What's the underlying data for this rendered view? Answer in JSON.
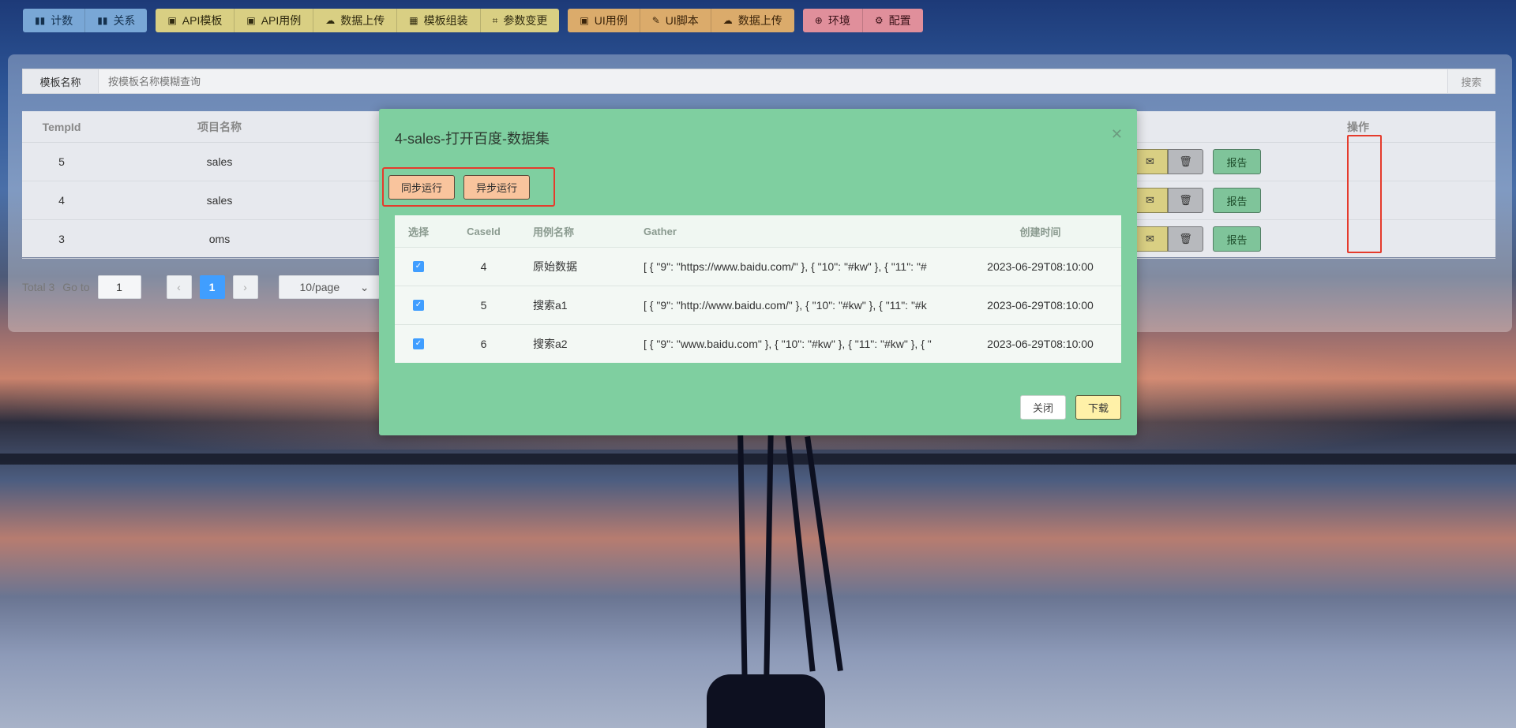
{
  "toolbar": {
    "groups": [
      {
        "color": "blue",
        "items": [
          {
            "icon": "bar-chart-icon",
            "label": "计数"
          },
          {
            "icon": "bar-chart-icon",
            "label": "关系"
          }
        ]
      },
      {
        "color": "yellow",
        "items": [
          {
            "icon": "clipboard-icon",
            "label": "API模板"
          },
          {
            "icon": "clipboard-icon",
            "label": "API用例"
          },
          {
            "icon": "cloud-upload-icon",
            "label": "数据上传"
          },
          {
            "icon": "grid-icon",
            "label": "模板组装"
          },
          {
            "icon": "crop-icon",
            "label": "参数变更"
          }
        ]
      },
      {
        "color": "orange",
        "items": [
          {
            "icon": "clipboard-icon",
            "label": "UI用例"
          },
          {
            "icon": "edit-icon",
            "label": "UI脚本"
          },
          {
            "icon": "cloud-upload-icon",
            "label": "数据上传"
          }
        ]
      },
      {
        "color": "pink",
        "items": [
          {
            "icon": "plus-circle-icon",
            "label": "环境"
          },
          {
            "icon": "gear-icon",
            "label": "配置"
          }
        ]
      }
    ]
  },
  "search": {
    "label": "模板名称",
    "placeholder": "按模板名称模糊查询",
    "button": "搜索"
  },
  "table": {
    "headers": {
      "id": "TempId",
      "project": "项目名称",
      "ops": "操作"
    },
    "rows": [
      {
        "id": "5",
        "project": "sales"
      },
      {
        "id": "4",
        "project": "sales"
      },
      {
        "id": "3",
        "project": "oms"
      }
    ],
    "report_label": "报告"
  },
  "pager": {
    "total": "Total 3",
    "goto": "Go to",
    "goto_value": "1",
    "current": "1",
    "page_size": "10/page"
  },
  "modal": {
    "title": "4-sales-打开百度-数据集",
    "run_sync": "同步运行",
    "run_async": "异步运行",
    "headers": {
      "select": "选择",
      "case": "CaseId",
      "name": "用例名称",
      "gather": "Gather",
      "time": "创建时间"
    },
    "rows": [
      {
        "checked": true,
        "case": "4",
        "name": "原始数据",
        "gather": "[ { \"9\": \"https://www.baidu.com/\" }, { \"10\": \"#kw\" }, { \"11\": \"#",
        "time": "2023-06-29T08:10:00"
      },
      {
        "checked": true,
        "case": "5",
        "name": "搜索a1",
        "gather": "[ { \"9\": \"http://www.baidu.com/\" }, { \"10\": \"#kw\" }, { \"11\": \"#k",
        "time": "2023-06-29T08:10:00"
      },
      {
        "checked": true,
        "case": "6",
        "name": "搜索a2",
        "gather": "[ { \"9\": \"www.baidu.com\" }, { \"10\": \"#kw\" }, { \"11\": \"#kw\" }, { \"",
        "time": "2023-06-29T08:10:00"
      }
    ],
    "close_label": "关闭",
    "download_label": "下载"
  },
  "colors": {
    "highlight": "#e53b2c",
    "modal_bg": "#7fcfa0",
    "accent": "#409eff"
  }
}
